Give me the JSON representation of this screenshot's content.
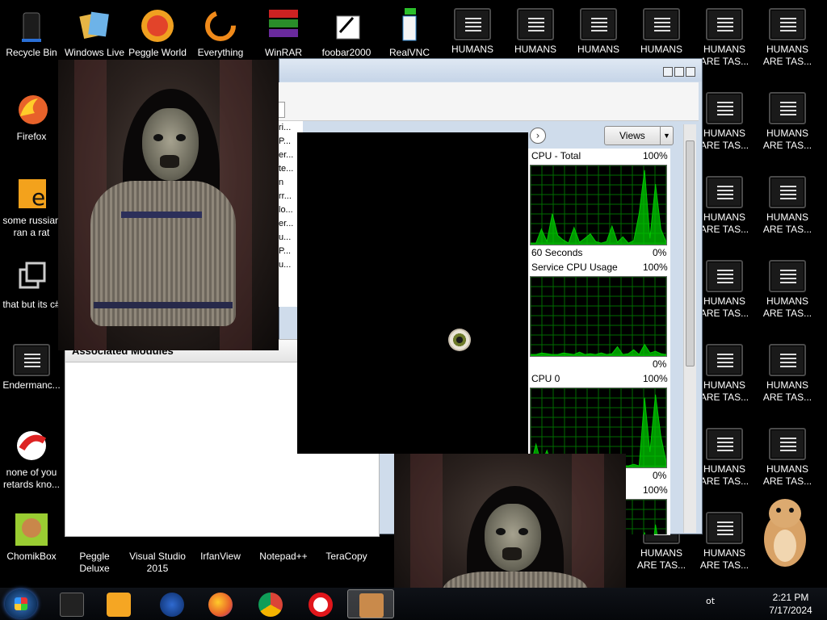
{
  "desktop_icons": {
    "recycle_bin": "Recycle Bin",
    "windows_live": "Windows Live",
    "peggle_world": "Peggle World",
    "everything": "Everything",
    "winrar": "WinRAR",
    "foobar": "foobar2000",
    "realvnc": "RealVNC",
    "humans": "HUMANS",
    "humans_are": "HUMANS ARE TAS...",
    "firefox": "Firefox",
    "russian": "some russian ran a rat",
    "thatbut": "that but its c#",
    "endermanc": "Endermanc...",
    "noneofyou": "none of you retards kno...",
    "chomikbox": "ChomikBox",
    "peggle_deluxe": "Peggle Deluxe",
    "visual_studio": "Visual Studio 2015",
    "irfanview": "IrfanView",
    "notepadpp": "Notepad++",
    "teracopy": "TeraCopy"
  },
  "perf_window": {
    "views": "Views",
    "associated_modules": "Associated Modules",
    "list_rows": [
      "ri...",
      "P...",
      "er...",
      "te...",
      "n",
      "rr...",
      "lo...",
      "er...",
      "u...",
      "P...",
      "u..."
    ],
    "graphs": [
      {
        "title": "CPU - Total",
        "top_pct": "100%",
        "footer": "60 Seconds",
        "bottom_pct": "0%"
      },
      {
        "title": "Service CPU Usage",
        "top_pct": "100%",
        "footer": "",
        "bottom_pct": "0%"
      },
      {
        "title": "CPU 0",
        "top_pct": "100%",
        "footer": "",
        "bottom_pct": "0%"
      },
      {
        "title": "",
        "top_pct": "100%",
        "footer": "",
        "bottom_pct": ""
      }
    ]
  },
  "taskbar": {
    "time": "2:21 PM",
    "date": "7/17/2024",
    "tray_label": "ot"
  },
  "colors": {
    "graph_green": "#00c800",
    "grid_green": "#006b00",
    "desktop_bg": "#000000"
  }
}
